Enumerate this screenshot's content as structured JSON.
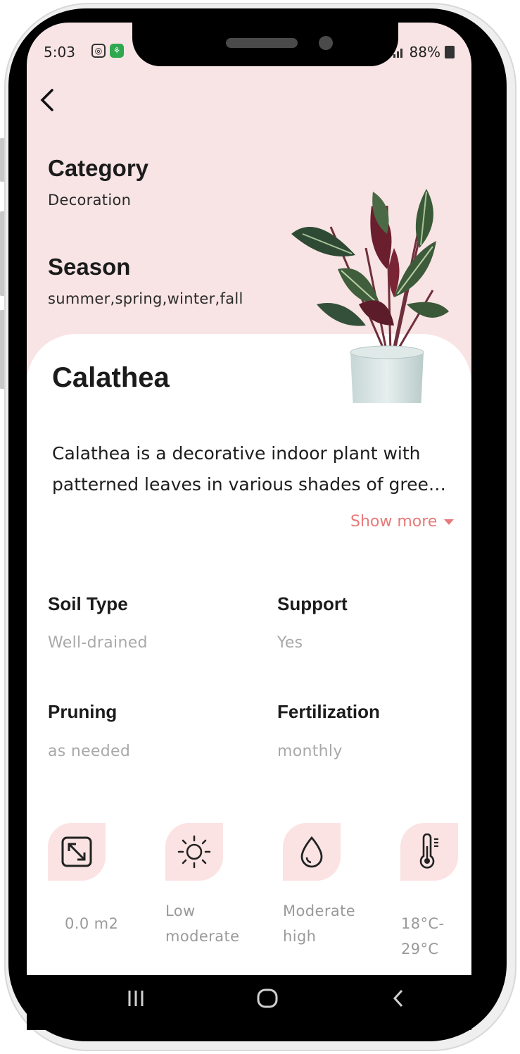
{
  "status_bar": {
    "time": "5:03",
    "battery": "88%"
  },
  "header": {
    "category_label": "Category",
    "category_value": "Decoration",
    "season_label": "Season",
    "season_value": "summer,spring,winter,fall"
  },
  "plant": {
    "name": "Calathea",
    "description": "Calathea is a decorative indoor plant with patterned leaves in various shades of gree…",
    "show_more": "Show more"
  },
  "attributes": [
    {
      "title": "Soil Type",
      "value": "Well-drained"
    },
    {
      "title": "Support",
      "value": "Yes"
    },
    {
      "title": "Pruning",
      "value": "as needed"
    },
    {
      "title": "Fertilization",
      "value": "monthly"
    }
  ],
  "stats": [
    {
      "icon": "area-resize-icon",
      "label": "0.0 m2"
    },
    {
      "icon": "sun-icon",
      "label_line1": "Low",
      "label_line2": "moderate"
    },
    {
      "icon": "water-drop-icon",
      "label_line1": "Moderate",
      "label_line2": "high"
    },
    {
      "icon": "thermometer-icon",
      "label": "18°C-29°C"
    }
  ],
  "colors": {
    "header_bg": "#f8e4e4",
    "accent": "#e87a7a",
    "icon_bg": "#fbe3e3"
  }
}
